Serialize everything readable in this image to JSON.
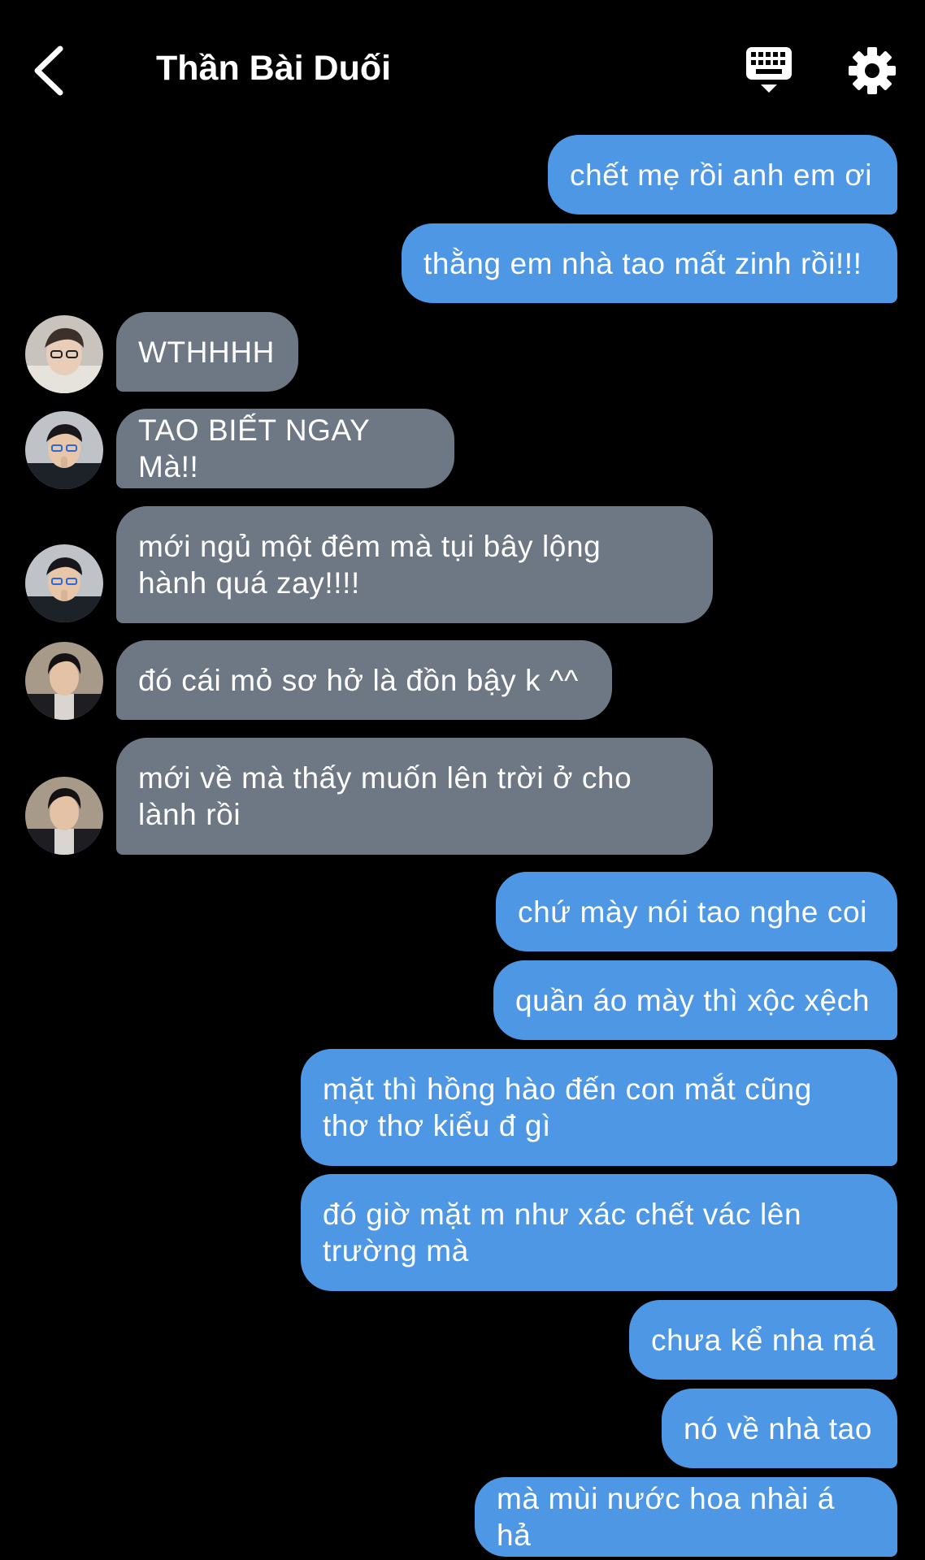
{
  "header": {
    "title": "Thần Bài Duối",
    "back_icon": "chevron-left-icon",
    "keyboard_icon": "keyboard-icon",
    "settings_icon": "gear-icon"
  },
  "colors": {
    "background": "#000000",
    "outgoing_bubble": "#4e97e4",
    "incoming_bubble": "#6d7884"
  },
  "messages": [
    {
      "side": "out",
      "text": "chết mẹ rồi anh em ơi"
    },
    {
      "side": "out",
      "text": "thằng em nhà tao mất zinh rồi!!!"
    },
    {
      "side": "in",
      "text": "WTHHHH"
    },
    {
      "side": "in",
      "text": "TAO BIẾT NGAY Mà!!"
    },
    {
      "side": "in",
      "text": "mới ngủ một đêm mà tụi bây lộng\nhành quá zay!!!!"
    },
    {
      "side": "in",
      "text": "đó cái mỏ sơ hở là đồn bậy k ^^"
    },
    {
      "side": "in",
      "text": "mới về mà thấy muốn lên trời ở cho\nlành rồi"
    },
    {
      "side": "out",
      "text": "chứ mày nói tao nghe coi"
    },
    {
      "side": "out",
      "text": "quần áo mày thì xộc xệch"
    },
    {
      "side": "out",
      "text": "mặt thì hồng hào đến con mắt cũng\nthơ thơ kiểu đ gì"
    },
    {
      "side": "out",
      "text": "đó giờ mặt m như xác chết vác lên\ntrường mà"
    },
    {
      "side": "out",
      "text": "chưa kể nha má"
    },
    {
      "side": "out",
      "text": "nó về nhà tao"
    },
    {
      "side": "out",
      "text": "mà mùi nước hoa nhài á hả"
    }
  ]
}
